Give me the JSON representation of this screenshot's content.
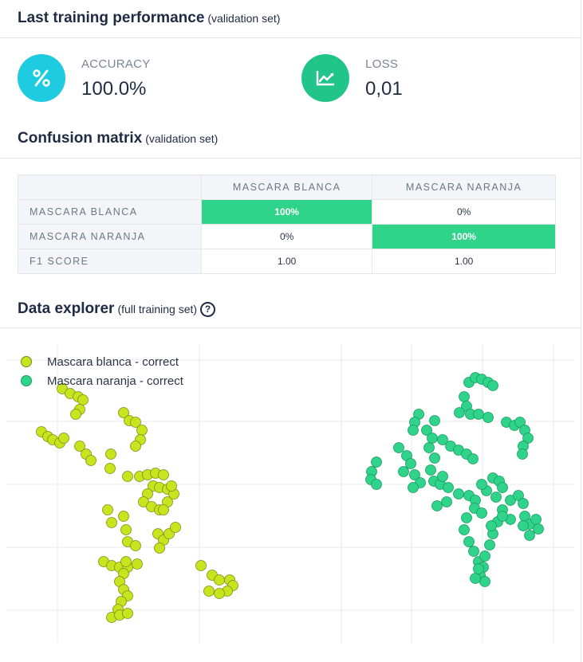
{
  "performance": {
    "title": "Last training performance",
    "subtitle": "(validation set)",
    "accuracy": {
      "label": "ACCURACY",
      "value": "100.0%",
      "icon": "percent-icon",
      "color": "#1ecbe1"
    },
    "loss": {
      "label": "LOSS",
      "value": "0,01",
      "icon": "trend-chart-icon",
      "color": "#22c589"
    }
  },
  "confusion": {
    "title": "Confusion matrix",
    "subtitle": "(validation set)",
    "columns": [
      "MASCARA BLANCA",
      "MASCARA NARANJA"
    ],
    "rows": [
      {
        "label": "MASCARA BLANCA",
        "cells": [
          "100%",
          "0%"
        ]
      },
      {
        "label": "MASCARA NARANJA",
        "cells": [
          "0%",
          "100%"
        ]
      }
    ],
    "f1": {
      "label": "F1 SCORE",
      "cells": [
        "1.00",
        "1.00"
      ]
    },
    "highlight_color": "#2fd38a"
  },
  "explorer": {
    "title": "Data explorer",
    "subtitle": "(full training set)",
    "help_icon": "question-circle-icon"
  },
  "chart_data": {
    "type": "scatter",
    "series": [
      {
        "name": "Mascara blanca - correct",
        "color": "#c6e51e",
        "points": [
          [
            78,
            488
          ],
          [
            88,
            494
          ],
          [
            98,
            498
          ],
          [
            104,
            502
          ],
          [
            100,
            514
          ],
          [
            95,
            520
          ],
          [
            52,
            542
          ],
          [
            60,
            548
          ],
          [
            66,
            552
          ],
          [
            75,
            556
          ],
          [
            80,
            550
          ],
          [
            100,
            560
          ],
          [
            108,
            570
          ],
          [
            114,
            578
          ],
          [
            139,
            570
          ],
          [
            138,
            588
          ],
          [
            155,
            518
          ],
          [
            162,
            528
          ],
          [
            170,
            530
          ],
          [
            178,
            540
          ],
          [
            176,
            552
          ],
          [
            170,
            560
          ],
          [
            160,
            598
          ],
          [
            175,
            598
          ],
          [
            185,
            596
          ],
          [
            195,
            594
          ],
          [
            205,
            596
          ],
          [
            192,
            610
          ],
          [
            200,
            612
          ],
          [
            210,
            614
          ],
          [
            185,
            620
          ],
          [
            180,
            630
          ],
          [
            190,
            636
          ],
          [
            200,
            640
          ],
          [
            210,
            630
          ],
          [
            218,
            620
          ],
          [
            215,
            610
          ],
          [
            205,
            640
          ],
          [
            135,
            640
          ],
          [
            140,
            656
          ],
          [
            155,
            648
          ],
          [
            158,
            665
          ],
          [
            160,
            680
          ],
          [
            170,
            685
          ],
          [
            198,
            670
          ],
          [
            205,
            678
          ],
          [
            200,
            688
          ],
          [
            212,
            670
          ],
          [
            220,
            662
          ],
          [
            130,
            705
          ],
          [
            140,
            710
          ],
          [
            150,
            712
          ],
          [
            160,
            712
          ],
          [
            172,
            708
          ],
          [
            158,
            705
          ],
          [
            155,
            720
          ],
          [
            150,
            730
          ],
          [
            155,
            740
          ],
          [
            160,
            748
          ],
          [
            152,
            755
          ],
          [
            148,
            765
          ],
          [
            140,
            775
          ],
          [
            150,
            772
          ],
          [
            160,
            770
          ],
          [
            252,
            710
          ],
          [
            266,
            722
          ],
          [
            275,
            728
          ],
          [
            288,
            728
          ],
          [
            292,
            735
          ],
          [
            285,
            742
          ],
          [
            275,
            745
          ],
          [
            262,
            742
          ]
        ]
      },
      {
        "name": "Mascara naranja - correct",
        "color": "#2fd38a",
        "points": [
          [
            472,
            580
          ],
          [
            466,
            592
          ],
          [
            465,
            602
          ],
          [
            472,
            608
          ],
          [
            500,
            562
          ],
          [
            510,
            572
          ],
          [
            515,
            582
          ],
          [
            506,
            592
          ],
          [
            520,
            596
          ],
          [
            527,
            606
          ],
          [
            518,
            612
          ],
          [
            525,
            520
          ],
          [
            520,
            530
          ],
          [
            518,
            540
          ],
          [
            535,
            540
          ],
          [
            542,
            550
          ],
          [
            545,
            528
          ],
          [
            538,
            562
          ],
          [
            545,
            575
          ],
          [
            540,
            590
          ],
          [
            544,
            604
          ],
          [
            552,
            608
          ],
          [
            562,
            612
          ],
          [
            575,
            620
          ],
          [
            588,
            622
          ],
          [
            596,
            628
          ],
          [
            595,
            638
          ],
          [
            585,
            650
          ],
          [
            582,
            665
          ],
          [
            588,
            680
          ],
          [
            594,
            692
          ],
          [
            600,
            705
          ],
          [
            606,
            712
          ],
          [
            602,
            722
          ],
          [
            608,
            730
          ],
          [
            596,
            726
          ],
          [
            600,
            714
          ],
          [
            608,
            698
          ],
          [
            614,
            684
          ],
          [
            618,
            670
          ],
          [
            624,
            655
          ],
          [
            630,
            640
          ],
          [
            640,
            628
          ],
          [
            650,
            622
          ],
          [
            656,
            632
          ],
          [
            658,
            648
          ],
          [
            664,
            658
          ],
          [
            672,
            652
          ],
          [
            675,
            664
          ],
          [
            664,
            672
          ],
          [
            656,
            660
          ],
          [
            640,
            652
          ],
          [
            630,
            648
          ],
          [
            616,
            660
          ],
          [
            604,
            644
          ],
          [
            588,
            480
          ],
          [
            596,
            474
          ],
          [
            604,
            476
          ],
          [
            612,
            480
          ],
          [
            618,
            484
          ],
          [
            582,
            498
          ],
          [
            585,
            510
          ],
          [
            576,
            518
          ],
          [
            590,
            520
          ],
          [
            600,
            520
          ],
          [
            612,
            524
          ],
          [
            635,
            530
          ],
          [
            645,
            534
          ],
          [
            652,
            530
          ],
          [
            658,
            540
          ],
          [
            662,
            550
          ],
          [
            656,
            560
          ],
          [
            655,
            570
          ],
          [
            555,
            552
          ],
          [
            565,
            560
          ],
          [
            575,
            565
          ],
          [
            585,
            570
          ],
          [
            593,
            576
          ],
          [
            560,
            630
          ],
          [
            548,
            635
          ],
          [
            555,
            598
          ],
          [
            618,
            600
          ],
          [
            626,
            604
          ],
          [
            630,
            612
          ],
          [
            622,
            624
          ],
          [
            610,
            616
          ],
          [
            604,
            608
          ]
        ]
      }
    ],
    "grid": true
  }
}
